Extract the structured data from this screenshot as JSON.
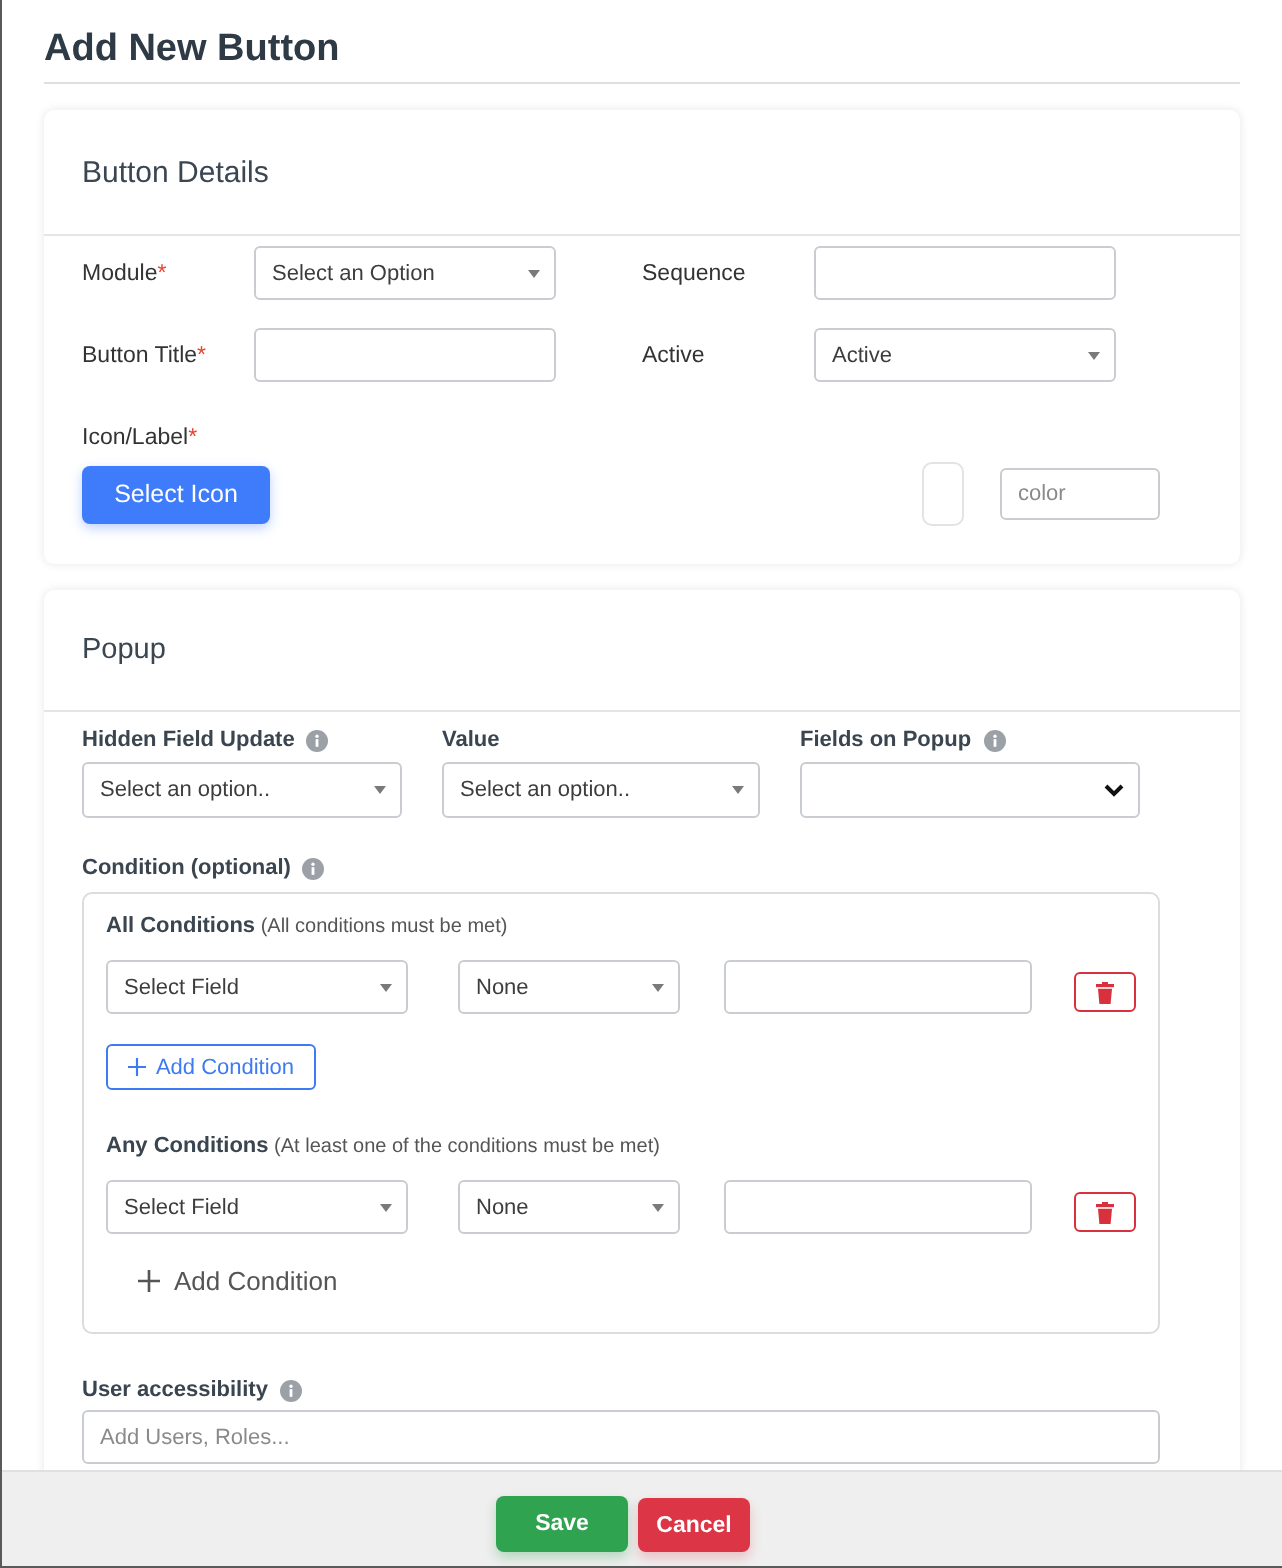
{
  "dialog": {
    "title": "Add New Button"
  },
  "button_details": {
    "title": "Button Details",
    "fields": [
      {
        "kind": "select",
        "label": "Module",
        "required_mark": "*",
        "value": "Select an Option"
      },
      {
        "kind": "input",
        "label": "Sequence"
      },
      {
        "kind": "input",
        "label": "Button Title",
        "required_mark": "*"
      },
      {
        "kind": "select",
        "label": "Active",
        "value": "Active"
      }
    ],
    "icon_label": {
      "label": "Icon/Label",
      "required_mark": "*",
      "button": "Select Icon",
      "color_placeholder": "color"
    }
  },
  "popup": {
    "title": "Popup",
    "fields": [
      {
        "kind": "select",
        "label": "Hidden Field Update",
        "info": true,
        "value": "Select an option.."
      },
      {
        "kind": "select",
        "label": "Value",
        "info": false,
        "value": "Select an option.."
      },
      {
        "kind": "native_select",
        "label": "Fields on Popup",
        "info": true
      }
    ],
    "condition": {
      "label": "Condition (optional)",
      "info": true,
      "groups": [
        {
          "heading": "**All Conditions** (All conditions must be met)",
          "rows": [
            {
              "field": "Select Field",
              "operator": "None"
            }
          ],
          "add_button": {
            "kind": "outlined",
            "label": "Add Condition"
          }
        },
        {
          "heading": "**Any Conditions** (At least one of the conditions must be met)",
          "rows": [
            {
              "field": "Select Field",
              "operator": "None"
            }
          ],
          "add_button": {
            "kind": "plain",
            "label": "Add Condition"
          }
        }
      ]
    },
    "user_accessibility": {
      "label": "User accessibility",
      "info": true,
      "placeholder": "Add Users, Roles..."
    }
  },
  "footer": {
    "buttons": [
      {
        "kind": "success",
        "label": "Save"
      },
      {
        "kind": "danger",
        "label": "Cancel"
      }
    ]
  }
}
